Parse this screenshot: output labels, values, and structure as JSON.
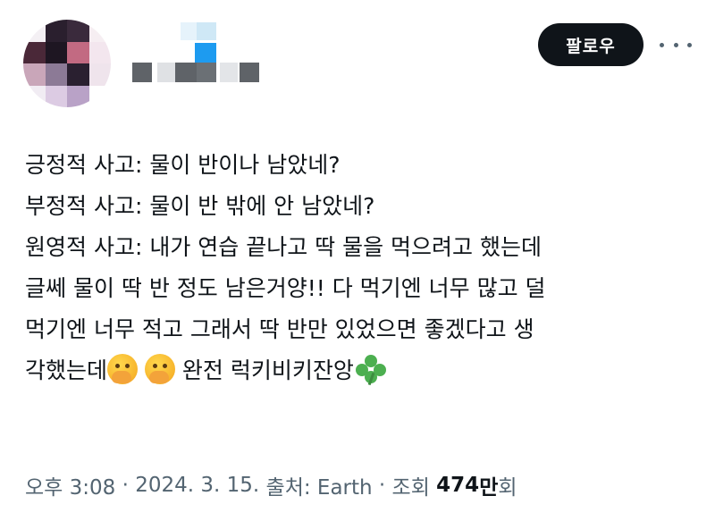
{
  "header": {
    "follow_label": "팔로우"
  },
  "tweet": {
    "lines": [
      "긍정적 사고: 물이 반이나 남았네?",
      "부정적 사고: 물이 반 밖에 안 남았네?",
      "원영적 사고: 내가 연습 끝나고 딱 물을 먹으려고 했는데",
      "글쎄 물이 딱 반 정도 남은거양!! 다 먹기엔 너무 많고 덜",
      "먹기엔 너무 적고 그래서 딱 반만 있었으면 좋겠다고 생",
      "각했는데",
      "완전 럭키비키잔앙"
    ],
    "emojis": [
      "face-with-hand-over-mouth-icon",
      "face-with-hand-over-mouth-icon",
      "four-leaf-clover-icon"
    ]
  },
  "meta": {
    "time": "오후 3:08",
    "sep1": " · ",
    "date": "2024. 3. 15.",
    "source": " 출처: Earth",
    "sep2": " · ",
    "views_label": "조회 ",
    "views_count": "474",
    "views_unit": "만",
    "views_suffix": "회"
  },
  "colors": {
    "text": "#0f1419",
    "secondary": "#536471",
    "follow_bg": "#0f1419",
    "follow_text": "#ffffff"
  }
}
